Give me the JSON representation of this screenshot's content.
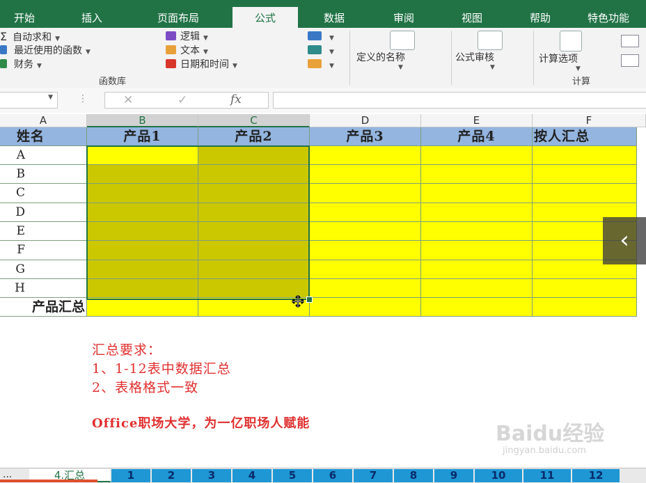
{
  "ribbon": {
    "tabs": [
      {
        "label": "开始",
        "active": false
      },
      {
        "label": "插入",
        "active": false
      },
      {
        "label": "页面布局",
        "active": false
      },
      {
        "label": "公式",
        "active": true
      },
      {
        "label": "数据",
        "active": false
      },
      {
        "label": "审阅",
        "active": false
      },
      {
        "label": "视图",
        "active": false
      },
      {
        "label": "帮助",
        "active": false
      },
      {
        "label": "特色功能",
        "active": false
      }
    ],
    "function_library": {
      "autosum": "自动求和",
      "recent": "最近使用的函数",
      "finance": "财务",
      "logic": "逻辑",
      "text": "文本",
      "datetime": "日期和时间",
      "group_label": "函数库"
    },
    "defined_names": "定义的名称",
    "formula_audit": "公式审核",
    "calc_options": "计算选项",
    "calc_group_label": "计算"
  },
  "formula_bar": {
    "fx": "fx",
    "cancel_icon": "✕",
    "enter_icon": "✓",
    "colon": "⋮"
  },
  "sheet": {
    "column_headers": [
      "A",
      "B",
      "C",
      "D",
      "E",
      "F"
    ],
    "header_row": [
      "姓名",
      "产品1",
      "产品2",
      "产品3",
      "产品4",
      "按人汇总"
    ],
    "row_names": [
      "A",
      "B",
      "C",
      "D",
      "E",
      "F",
      "G",
      "H"
    ],
    "total_row_label": "产品汇总"
  },
  "notes": {
    "title": "汇总要求：",
    "line1": "1、1-12表中数据汇总",
    "line2": "2、表格格式一致",
    "slogan": "Office职场大学，为一亿职场人赋能"
  },
  "sheet_tabs": {
    "more": "...",
    "current": "4.汇总",
    "numbers": [
      "1",
      "2",
      "3",
      "4",
      "5",
      "6",
      "7",
      "8",
      "9",
      "10",
      "11",
      "12"
    ]
  },
  "nav": {
    "prev_arrow": "‹"
  },
  "watermark": {
    "brand": "Baidu经验",
    "url": "jingyan.baidu.com"
  },
  "colors": {
    "excel_green": "#217346",
    "header_blue": "#93b5df",
    "cell_yellow": "#ffff00",
    "selection_olive": "#cbc800",
    "note_red": "#e03030",
    "sheet_tab_blue": "#1e97d4"
  }
}
